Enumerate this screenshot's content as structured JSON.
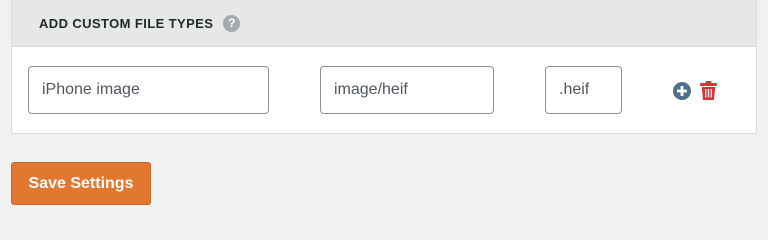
{
  "panel": {
    "title": "ADD CUSTOM FILE TYPES",
    "help_glyph": "?",
    "help_icon": "help-circle-icon"
  },
  "row": {
    "name_value": "iPhone image",
    "mime_value": "image/heif",
    "extension_value": ".heif",
    "add_icon": "plus-circle-icon",
    "delete_icon": "trash-icon"
  },
  "actions": {
    "save_label": "Save Settings"
  },
  "colors": {
    "header_bg": "#e6e7e7",
    "accent": "#e27730",
    "add_icon": "#4f6f8c",
    "delete_icon": "#d63638"
  }
}
